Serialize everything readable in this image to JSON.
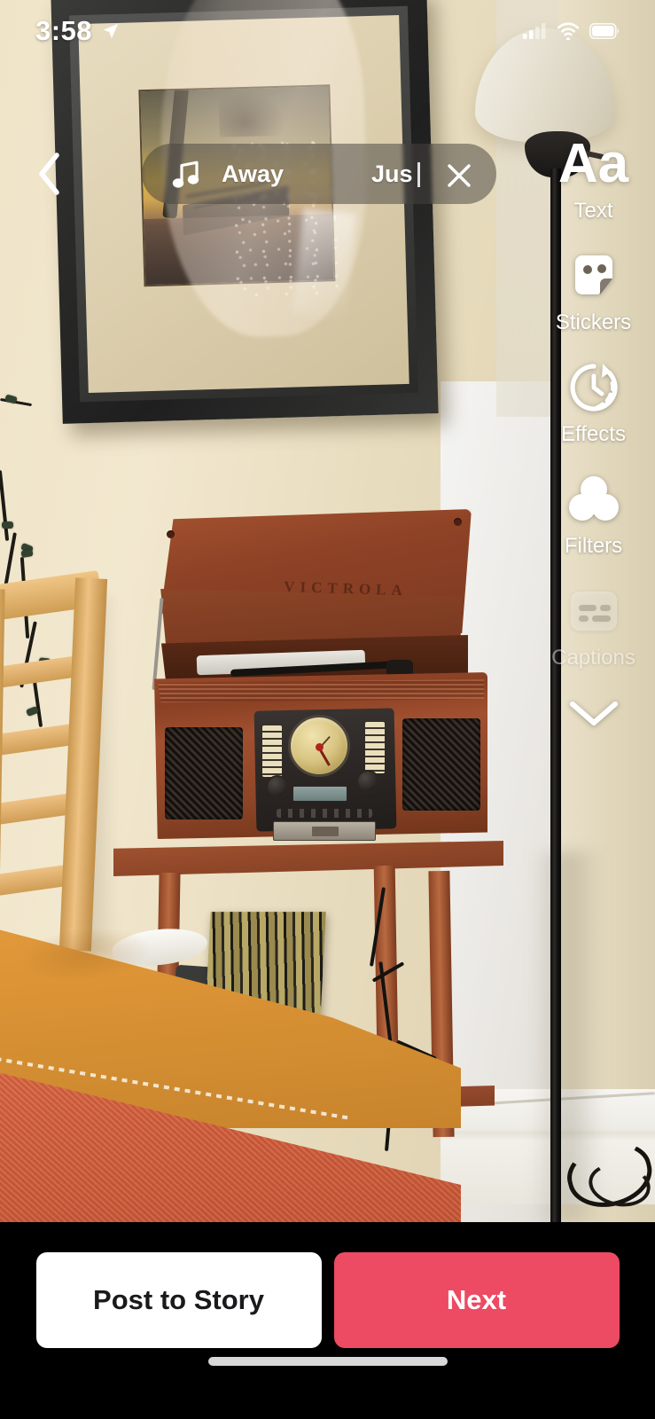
{
  "status_bar": {
    "time": "3:58",
    "location_icon": "location-arrow-icon",
    "cellular_icon": "cellular-signal-icon",
    "wifi_icon": "wifi-icon",
    "battery_icon": "battery-full-icon"
  },
  "nav": {
    "back_icon": "chevron-left-icon"
  },
  "music_pill": {
    "note_icon": "music-note-icon",
    "title": "Away",
    "subtitle": "Jus",
    "close_icon": "close-x-icon"
  },
  "tool_rail": {
    "items": [
      {
        "label": "Text",
        "icon": "text-aa-icon",
        "enabled": true
      },
      {
        "label": "Stickers",
        "icon": "sticker-icon",
        "enabled": true
      },
      {
        "label": "Effects",
        "icon": "effects-clock-icon",
        "enabled": true
      },
      {
        "label": "Filters",
        "icon": "filters-circles-icon",
        "enabled": true
      },
      {
        "label": "Captions",
        "icon": "captions-icon",
        "enabled": false
      }
    ],
    "more_icon": "chevron-down-icon"
  },
  "bottom_bar": {
    "post_to_story_label": "Post to Story",
    "next_label": "Next"
  },
  "photo": {
    "wall_art_brand": "VICTROLA"
  },
  "colors": {
    "accent_pink": "#ed4a63",
    "button_white": "#ffffff",
    "bar_black": "#000000",
    "overlay_pill": "rgba(70,68,64,0.52)"
  }
}
